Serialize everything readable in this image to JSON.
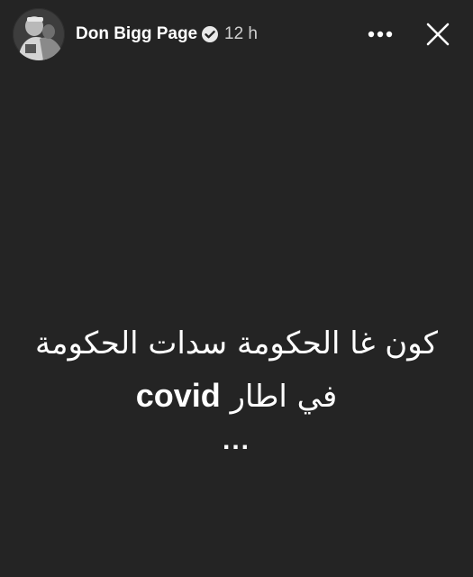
{
  "header": {
    "user_name": "Don Bigg Page",
    "time_ago": "12 h",
    "verified_icon": "verified-badge-icon",
    "more_icon": "more-horizontal-icon",
    "close_icon": "close-icon"
  },
  "story": {
    "line1": "كون غا الحكومة سدات الحكومة",
    "line2_arabic": "في اطار",
    "line2_latin": "covid",
    "line3": "..."
  },
  "colors": {
    "background": "#242424",
    "text": "#ffffff",
    "secondary_text": "#cfcfcf"
  }
}
